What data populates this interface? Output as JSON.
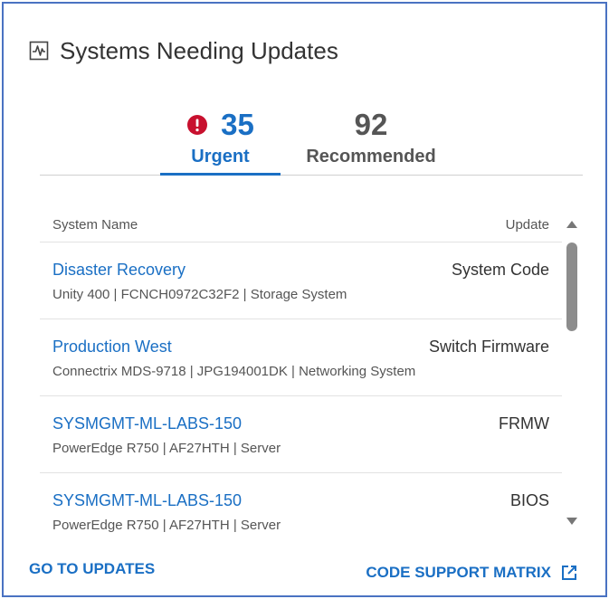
{
  "header": {
    "title": "Systems Needing Updates",
    "icon": "activity-chart-icon"
  },
  "tabs": [
    {
      "count": "35",
      "label": "Urgent",
      "icon": "alert-circle-icon",
      "color": "#1a6fc4"
    },
    {
      "count": "92",
      "label": "Recommended"
    }
  ],
  "table": {
    "columns": {
      "name": "System Name",
      "update": "Update"
    },
    "rows": [
      {
        "name": "Disaster Recovery",
        "update": "System Code",
        "detail": "Unity 400 | FCNCH0972C32F2 | Storage System"
      },
      {
        "name": "Production West",
        "update": "Switch Firmware",
        "detail": "Connectrix MDS-9718 | JPG194001DK | Networking System"
      },
      {
        "name": "SYSMGMT-ML-LABS-150",
        "update": "FRMW",
        "detail": "PowerEdge R750 | AF27HTH | Server"
      },
      {
        "name": "SYSMGMT-ML-LABS-150",
        "update": "BIOS",
        "detail": "PowerEdge R750 | AF27HTH | Server"
      }
    ]
  },
  "footer": {
    "go_to_updates": "GO TO UPDATES",
    "code_support_matrix": "CODE SUPPORT MATRIX",
    "external_icon": "external-link-icon"
  },
  "colors": {
    "accent": "#1a6fc4",
    "alert": "#c8102e",
    "border": "#4a72c2"
  }
}
